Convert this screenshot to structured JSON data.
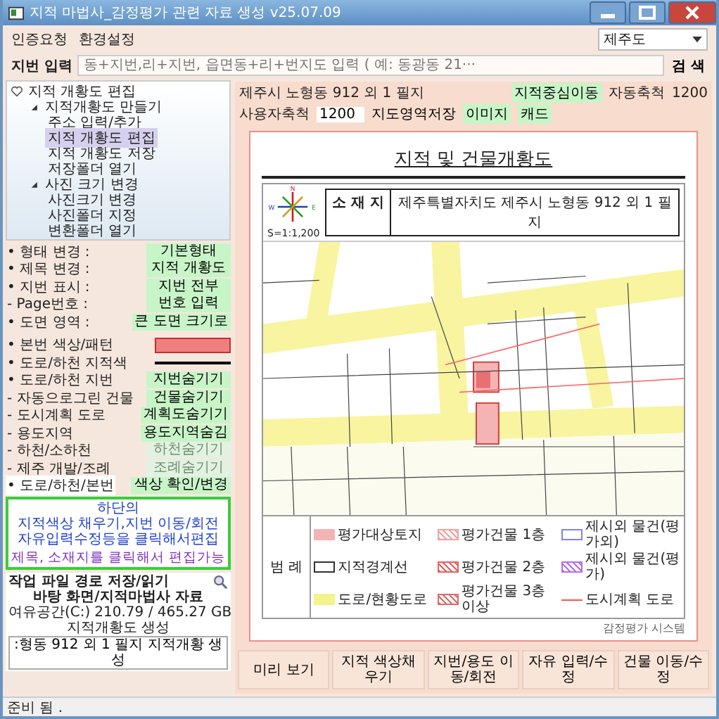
{
  "window": {
    "title": "지적 마법사_감정평가 관련 자료 생성 v25.07.09"
  },
  "menu": [
    {
      "label": "인증요청"
    },
    {
      "label": "환경설정"
    }
  ],
  "region_select": {
    "value": "제주도"
  },
  "lot_search": {
    "label": "지번 입력",
    "placeholder": "동+지번,리+지번, 읍면동+리+번지도 입력 ( 예: 동광동 21···",
    "button": "검 색"
  },
  "tree": [
    {
      "label": "지적 개황도 편집",
      "selected": false,
      "expanded": true,
      "children": [
        {
          "label": "지적개황도 만들기",
          "selected": false,
          "expanded": true,
          "children": [
            {
              "label": "주소 입력/추가",
              "selected": false
            },
            {
              "label": "지적 개황도 편집",
              "selected": true
            },
            {
              "label": "지적 개황도 저장",
              "selected": false
            },
            {
              "label": "저장폴더 열기",
              "selected": false
            }
          ]
        },
        {
          "label": "사진 크기 변경",
          "selected": false,
          "expanded": true,
          "children": [
            {
              "label": "사진크기 변경",
              "selected": false
            },
            {
              "label": "사진폴더 지정",
              "selected": false
            },
            {
              "label": "변환폴더 열기",
              "selected": false
            }
          ]
        }
      ]
    }
  ],
  "settings_top": [
    {
      "label": "• 형태 변경 :",
      "value": "기본형태"
    },
    {
      "label": "• 제목 변경 :",
      "value": "지적 개황도"
    },
    {
      "label": "• 지번 표시 :",
      "value": "지번 전부"
    },
    {
      "label": "- Page번호 :",
      "value": "번호 입력"
    },
    {
      "label": "• 도면 영역 :",
      "value": "큰 도면 크기로"
    }
  ],
  "settings_bottom": [
    {
      "label": "• 본번 색상/패턴",
      "kind": "swatch",
      "color": "#f08080",
      "highlighted": false
    },
    {
      "label": "• 도로/하천 지적색",
      "kind": "line",
      "color": "#000000",
      "highlighted": false
    },
    {
      "label": "• 도로/하천 지번",
      "kind": "button",
      "value": "지번숨기기",
      "disabled": false,
      "highlighted": false
    },
    {
      "label": "- 자동으로그린 건물",
      "kind": "button",
      "value": "건물숨기기",
      "disabled": false,
      "highlighted": false
    },
    {
      "label": "- 도시계획 도로",
      "kind": "button",
      "value": "계획도숨기기",
      "disabled": false,
      "highlighted": false
    },
    {
      "label": "- 용도지역",
      "kind": "button",
      "value": "용도지역숨김",
      "disabled": false,
      "highlighted": false
    },
    {
      "label": "- 하천/소하천",
      "kind": "button",
      "value": "하천숨기기",
      "disabled": true,
      "highlighted": false
    },
    {
      "label": "- 제주 개발/조례",
      "kind": "button",
      "value": "조례숨기기",
      "disabled": true,
      "highlighted": false
    },
    {
      "label": "• 도로/하천/본번",
      "kind": "button",
      "value": "색상 확인/변경",
      "disabled": false,
      "highlighted": true
    }
  ],
  "info_box": {
    "lines": [
      "하단의",
      "지적색상 채우기,지번 이동/회전",
      "자유입력수정등을 클릭해서편집"
    ],
    "note": "제목, 소재지를 클릭해서 편집가능"
  },
  "work": {
    "path_label": "작업 파일 경로 저장/읽기",
    "path": "바탕 화면/지적마법사 자료",
    "disk_label": "여유공간(C:)",
    "disk_value": "210.79 / 465.27 GB",
    "generate_label": "지적개황도 생성",
    "generate_button": ":형동 912 외 1 필지 지적개황 생성"
  },
  "doc_bar": {
    "address": "제주시 노형동 912 외 1 필지",
    "center_move": "지적중심이동",
    "auto_scale_label": "자동축척",
    "auto_scale": "1200",
    "user_scale_label": "사용자축척",
    "user_scale": "1200",
    "save_area": "지도영역저장",
    "exports": [
      "이미지",
      "캐드"
    ]
  },
  "document": {
    "title": "지적 및 건물개황도",
    "compass": {
      "n": "N",
      "w": "W",
      "e": "E"
    },
    "scale": "S=1:1,200",
    "location_label": "소 재 지",
    "location": "제주특별자치도 제주시 노형동 912 외 1 필지",
    "legend_title": "범 례",
    "legend": [
      {
        "label": "평가대상토지",
        "kind": "fill",
        "color": "#f4b4b4"
      },
      {
        "label": "평가건물 1층",
        "kind": "hatch",
        "color": "#f4a0a0"
      },
      {
        "label": "제시외 물건(평가외)",
        "kind": "outline",
        "color": "#8080ff"
      },
      {
        "label": "지적경계선",
        "kind": "outline",
        "color": "#333333"
      },
      {
        "label": "평가건물 2층",
        "kind": "hatch",
        "color": "#e86060"
      },
      {
        "label": "제시외 물건(평가)",
        "kind": "hatch",
        "color": "#b070f0"
      },
      {
        "label": "도로/현황도로",
        "kind": "fill",
        "color": "#f4f48a"
      },
      {
        "label": "평가건물 3층이상",
        "kind": "hatch",
        "color": "#e06a6a"
      },
      {
        "label": "도시계획 도로",
        "kind": "line",
        "color": "#ff5050"
      }
    ],
    "footer": "감정평가 시스템"
  },
  "bottom_buttons": [
    "미리 보기",
    "지적 색상채우기",
    "지번/용도 이동/회전",
    "자유 입력/수정",
    "건물 이동/수정"
  ],
  "status": "준비 됨 ."
}
